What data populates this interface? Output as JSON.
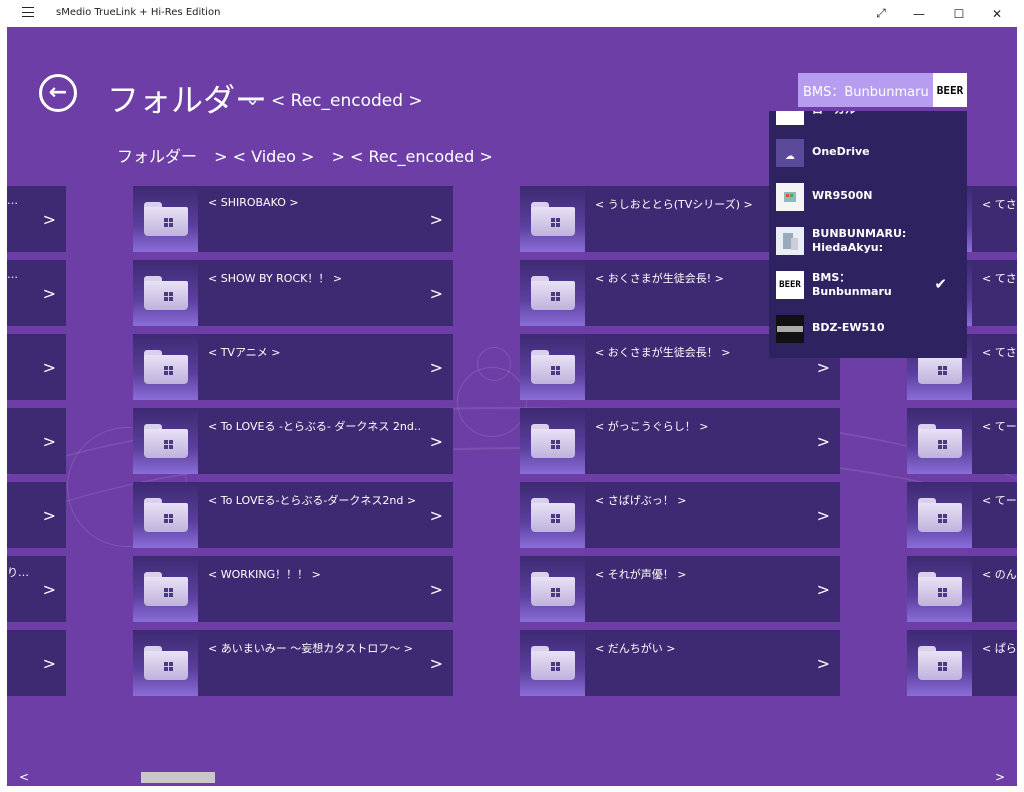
{
  "window": {
    "title": "sMedio TrueLink + Hi-Res Edition",
    "controls": [
      "⤢",
      "—",
      "☐",
      "✕"
    ]
  },
  "header": {
    "back_icon": "back-arrow-icon",
    "title": "フォルダー",
    "subtitle": "< Rec_encoded >"
  },
  "breadcrumb": [
    "フォルダー",
    "> < Video >",
    "> < Rec_encoded >"
  ],
  "device": {
    "name": "BMS：Bunbunmaru",
    "logo": "BEER"
  },
  "dropdown": [
    {
      "name": "ローカル",
      "icon": "",
      "checked": false
    },
    {
      "name": "OneDrive",
      "icon": "cloud-icon",
      "checked": false
    },
    {
      "name": "WR9500N",
      "icon": "router-icon",
      "checked": false
    },
    {
      "name": "BUNBUNMARU:\nHiedaAkyu:",
      "icon": "pc-icon",
      "checked": false
    },
    {
      "name": "BMS：\nBunbunmaru",
      "icon": "BEER",
      "checked": true
    },
    {
      "name": "BDZ-EW510",
      "icon": "recorder-icon",
      "checked": false
    }
  ],
  "folders": {
    "col1": [
      "< SHIROBAKO >",
      "< SHOW BY ROCK！！ >",
      "< TVアニメ >",
      "< To LOVEる -とらぶる- ダークネス 2nd…",
      "< To LOVEる-とらぶる-ダークネス2nd >",
      "< WORKING！！！ >",
      "< あいまいみー ～妄想カタストロフ～ >"
    ],
    "col2": [
      "< うしおととら(TVシリーズ) >",
      "< おくさまが生徒会長! >",
      "< おくさまが生徒会長！ >",
      "< がっこうぐらし！ >",
      "< さばげぶっ！ >",
      "< それが声優！ >",
      "< だんちがい >"
    ],
    "col3": [
      "< てさぐ",
      "< てさぐ",
      "< てさぐ",
      "< てーき",
      "< てーき",
      "< のんの",
      "< ぱらが"
    ],
    "edge": [
      "…",
      "…",
      "",
      "",
      "",
      "り…",
      ""
    ]
  },
  "arrow_glyph": ">",
  "scroll": {
    "left": "<",
    "right": ">"
  }
}
